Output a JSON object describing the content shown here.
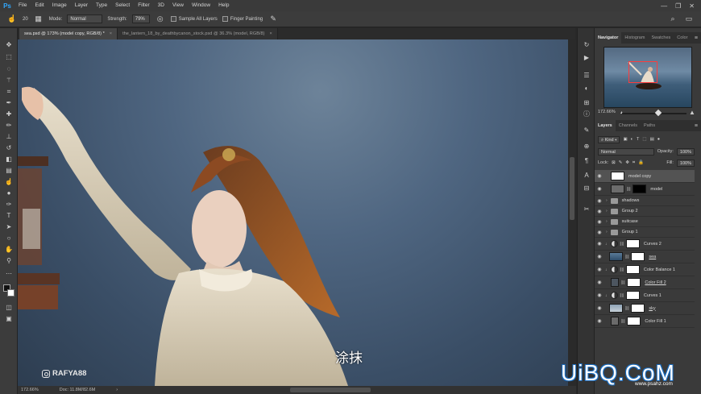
{
  "app": {
    "logo": "Ps"
  },
  "menu": [
    "File",
    "Edit",
    "Image",
    "Layer",
    "Type",
    "Select",
    "Filter",
    "3D",
    "View",
    "Window",
    "Help"
  ],
  "window_controls": [
    "—",
    "❐",
    "✕"
  ],
  "options": {
    "brush_size": "20",
    "mode_label": "Mode:",
    "mode_value": "Normal",
    "strength_label": "Strength:",
    "strength_value": "79%",
    "sample_all_layers": "Sample All Layers",
    "finger_painting": "Finger Painting"
  },
  "tabs": [
    {
      "label": "sea.psd @ 173% (model copy, RGB/8) *",
      "active": true
    },
    {
      "label": "the_lantern_18_by_deathbycanon_stock.psd @ 36.3% (model, RGB/8)",
      "active": false
    }
  ],
  "status": {
    "zoom": "172.66%",
    "doc": "Doc: 11.8M/82.6M"
  },
  "navigator": {
    "tabs": [
      "Navigator",
      "Histogram",
      "Swatches",
      "Color"
    ],
    "zoom": "172.66%"
  },
  "layers_panel": {
    "tabs": [
      "Layers",
      "Channels",
      "Paths"
    ],
    "kind": "Kind",
    "blend": "Normal",
    "opacity_label": "Opacity:",
    "opacity_value": "100%",
    "lock_label": "Lock:",
    "fill_label": "Fill:",
    "fill_value": "100%",
    "layers": [
      {
        "name": "model copy",
        "type": "pixel",
        "selected": true
      },
      {
        "name": "model",
        "type": "pixel-mask"
      },
      {
        "name": "shadows",
        "type": "group"
      },
      {
        "name": "Group 2",
        "type": "group"
      },
      {
        "name": "suitcase",
        "type": "group"
      },
      {
        "name": "Group 1",
        "type": "group"
      },
      {
        "name": "Curves 2",
        "type": "adjustment"
      },
      {
        "name": "sea",
        "type": "pixel-mask"
      },
      {
        "name": "Color Balance 1",
        "type": "adjustment"
      },
      {
        "name": "Color Fill 2",
        "type": "fill"
      },
      {
        "name": "Curves 1",
        "type": "adjustment"
      },
      {
        "name": "sky",
        "type": "pixel-mask"
      },
      {
        "name": "Color Fill 1",
        "type": "fill"
      }
    ]
  },
  "overlay": {
    "subtitle": "涂抹",
    "instagram": "RAFYA88",
    "watermark": "UiBQ.CoM",
    "watermark_sub": "www.psahz.com"
  }
}
